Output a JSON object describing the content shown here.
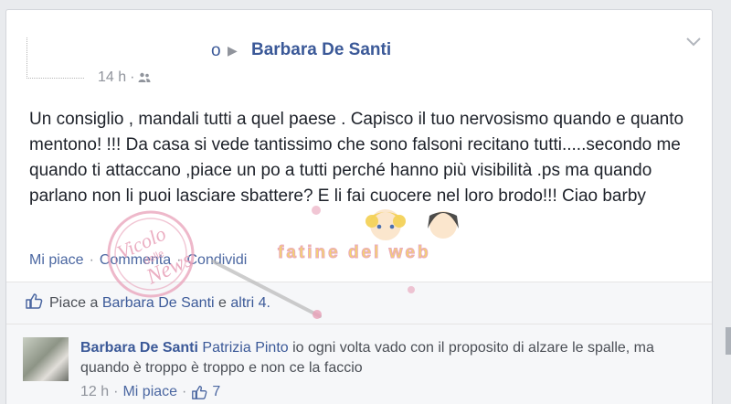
{
  "post": {
    "author_stub": "o",
    "author": "Barbara De Santi",
    "time": "14 h",
    "meta_dot": "·",
    "text": "Un consiglio , mandali tutti a quel paese . Capisco il tuo nervosismo quando e quanto mentono! !!! Da casa si vede tantissimo che sono falsoni recitano tutti.....secondo me quando ti attaccano ,piace un po a tutti perché hanno più visibilità .ps ma quando parlano non li puoi lasciare sbattere? E li fai cuocere nel loro brodo!!! Ciao barby",
    "actions": {
      "like": "Mi piace",
      "comment": "Commenta",
      "share": "Condividi",
      "sep": "·"
    }
  },
  "likes_bar": {
    "prefix": "Piace a",
    "name": "Barbara De Santi",
    "middle": "e",
    "others": "altri 4."
  },
  "comment": {
    "author": "Barbara De Santi",
    "tag": "Patrizia Pinto",
    "text": "io ogni volta vado con il proposito di alzare le spalle, ma quando è troppo è troppo e non ce la faccio",
    "time": "12 h",
    "sep": "·",
    "like": "Mi piace",
    "like_count": "7"
  },
  "watermarks": {
    "stamp_line1": "Vicolo",
    "stamp_line2": "delle",
    "stamp_line3": "News",
    "banner": "fatine del web"
  },
  "colors": {
    "link": "#3b5998",
    "muted": "#90949c",
    "text": "#1d2129",
    "background": "#e9ebee",
    "watermark_pink": "#e8a0b8",
    "watermark_yellow": "#f3d25a"
  }
}
